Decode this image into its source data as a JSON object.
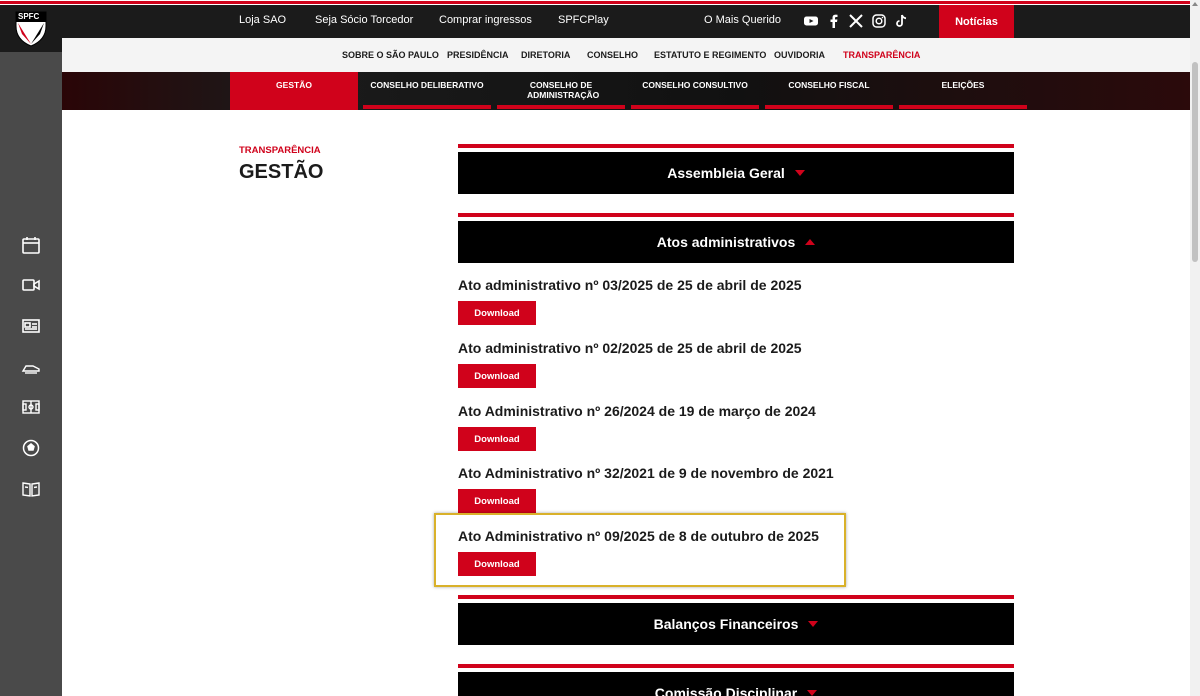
{
  "header": {
    "nav": [
      "Loja SAO",
      "Seja Sócio Torcedor",
      "Comprar ingressos",
      "SPFCPlay",
      "O Mais Querido"
    ],
    "noticias": "Notícias",
    "social_icons": [
      "youtube-icon",
      "facebook-icon",
      "x-icon",
      "instagram-icon",
      "tiktok-icon"
    ],
    "logo_text": "SPFC"
  },
  "subnav": {
    "items": [
      "SOBRE O SÃO PAULO",
      "PRESIDÊNCIA",
      "DIRETORIA",
      "CONSELHO",
      "ESTATUTO E REGIMENTO",
      "OUVIDORIA",
      "TRANSPARÊNCIA"
    ],
    "active": "TRANSPARÊNCIA"
  },
  "categories": {
    "items": [
      "GESTÃO",
      "CONSELHO DELIBERATIVO",
      "CONSELHO DE ADMINISTRAÇÃO",
      "CONSELHO CONSULTIVO",
      "CONSELHO FISCAL",
      "ELEIÇÕES"
    ],
    "active": "GESTÃO"
  },
  "page": {
    "breadcrumb": "TRANSPARÊNCIA",
    "title": "GESTÃO"
  },
  "accordions": [
    {
      "title": "Assembleia Geral",
      "expanded": false
    },
    {
      "title": "Atos administrativos",
      "expanded": true
    },
    {
      "title": "Balanços Financeiros",
      "expanded": false
    },
    {
      "title": "Comissão Disciplinar",
      "expanded": false
    }
  ],
  "atos": [
    {
      "title": "Ato administrativo nº 03/2025 de 25 de abril de 2025",
      "button": "Download"
    },
    {
      "title": "Ato administrativo nº 02/2025 de 25 de abril de 2025",
      "button": "Download"
    },
    {
      "title": "Ato Administrativo nº 26/2024 de 19 de março de 2024",
      "button": "Download"
    },
    {
      "title": "Ato Administrativo nº 32/2021 de 9 de novembro de 2021",
      "button": "Download"
    },
    {
      "title": "Ato Administrativo nº 09/2025 de 8 de outubro de 2025",
      "button": "Download"
    }
  ],
  "sidebar_icons": [
    "calendar-icon",
    "video-icon",
    "news-icon",
    "boot-icon",
    "field-icon",
    "ball-icon",
    "book-icon"
  ],
  "colors": {
    "brand_red": "#d0021b",
    "dark": "#1b1b1b",
    "sidebar": "#4a4a4a",
    "highlight": "#d9b12a"
  }
}
